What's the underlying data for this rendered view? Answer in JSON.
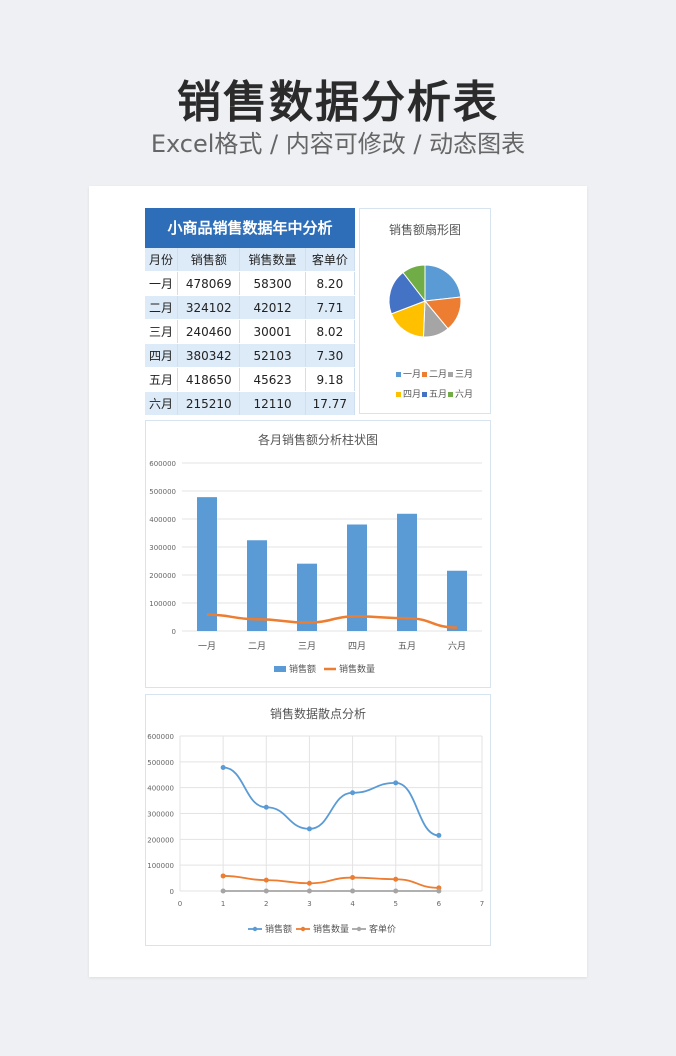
{
  "header": {
    "title": "销售数据分析表",
    "subtitle": "Excel格式 / 内容可修改 / 动态图表"
  },
  "table": {
    "title": "小商品销售数据年中分析",
    "columns": [
      "月份",
      "销售额",
      "销售数量",
      "客单价"
    ],
    "rows": [
      [
        "一月",
        "478069",
        "58300",
        "8.20"
      ],
      [
        "二月",
        "324102",
        "42012",
        "7.71"
      ],
      [
        "三月",
        "240460",
        "30001",
        "8.02"
      ],
      [
        "四月",
        "380342",
        "52103",
        "7.30"
      ],
      [
        "五月",
        "418650",
        "45623",
        "9.18"
      ],
      [
        "六月",
        "215210",
        "12110",
        "17.77"
      ]
    ]
  },
  "chart_data": [
    {
      "type": "pie",
      "title": "销售额扇形图",
      "categories": [
        "一月",
        "二月",
        "三月",
        "四月",
        "五月",
        "六月"
      ],
      "values": [
        478069,
        324102,
        240460,
        380342,
        418650,
        215210
      ],
      "colors": [
        "#5b9bd5",
        "#ed7d31",
        "#a5a5a5",
        "#ffc000",
        "#4472c4",
        "#70ad47"
      ],
      "legend": "bottom"
    },
    {
      "type": "bar",
      "title": "各月销售额分析柱状图",
      "categories": [
        "一月",
        "二月",
        "三月",
        "四月",
        "五月",
        "六月"
      ],
      "series": [
        {
          "name": "销售额",
          "values": [
            478069,
            324102,
            240460,
            380342,
            418650,
            215210
          ],
          "color": "#5b9bd5",
          "kind": "bar"
        },
        {
          "name": "销售数量",
          "values": [
            58300,
            42012,
            30001,
            52103,
            45623,
            12110
          ],
          "color": "#ed7d31",
          "kind": "line"
        }
      ],
      "yticks": [
        "0",
        "100000",
        "200000",
        "300000",
        "400000",
        "500000",
        "600000"
      ],
      "ylim": [
        0,
        600000
      ],
      "grid": true,
      "legend": "bottom"
    },
    {
      "type": "scatter",
      "title": "销售数据散点分析",
      "x": [
        1,
        2,
        3,
        4,
        5,
        6
      ],
      "series": [
        {
          "name": "销售额",
          "values": [
            478069,
            324102,
            240460,
            380342,
            418650,
            215210
          ],
          "color": "#5b9bd5"
        },
        {
          "name": "销售数量",
          "values": [
            58300,
            42012,
            30001,
            52103,
            45623,
            12110
          ],
          "color": "#ed7d31"
        },
        {
          "name": "客单价",
          "values": [
            8.2,
            7.71,
            8.02,
            7.3,
            9.18,
            17.77
          ],
          "color": "#a5a5a5"
        }
      ],
      "xticks": [
        "0",
        "1",
        "2",
        "3",
        "4",
        "5",
        "6",
        "7"
      ],
      "yticks": [
        "0",
        "100000",
        "200000",
        "300000",
        "400000",
        "500000",
        "600000"
      ],
      "xlim": [
        0,
        7
      ],
      "ylim": [
        0,
        600000
      ],
      "grid": true,
      "legend": "bottom"
    }
  ]
}
